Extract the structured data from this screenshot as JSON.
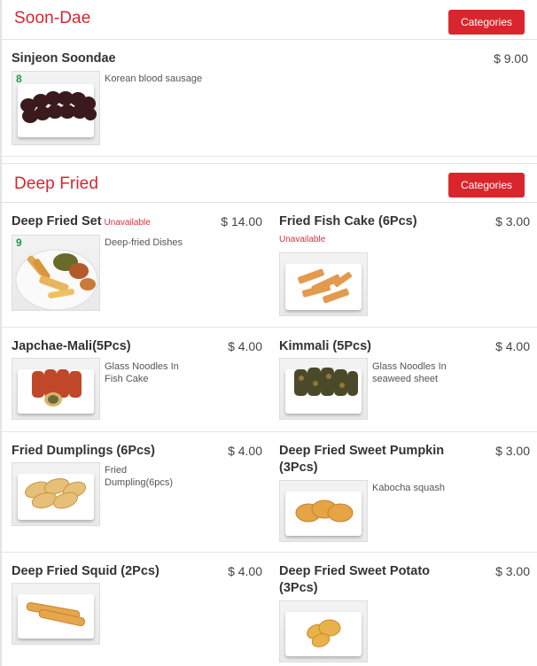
{
  "sections": [
    {
      "title": "Soon-Dae",
      "button": "Categories",
      "items": [
        {
          "name": "Sinjeon Soondae",
          "price": "$ 9.00",
          "desc": "Korean blood sausage",
          "badge": "8",
          "image": "soondae-slices"
        }
      ]
    },
    {
      "title": "Deep Fried",
      "button": "Categories",
      "items": [
        {
          "name": "Deep Fried Set",
          "unavailable": "Unavailable",
          "price": "$ 14.00",
          "desc": "Deep-fried Dishes",
          "badge": "9",
          "image": "fried-platter"
        },
        {
          "name": "Fried Fish Cake (6Pcs)",
          "unavailable": "Unavailable",
          "price": "$ 3.00",
          "desc": "",
          "image": "fish-cake"
        },
        {
          "name": "Japchae-Mali(5Pcs)",
          "price": "$ 4.00",
          "desc_line1": "Glass Noodles In",
          "desc_line2": "Fish Cake",
          "image": "japchae-rolls"
        },
        {
          "name": "Kimmali (5Pcs)",
          "price": "$ 4.00",
          "desc_line1": "Glass Noodles In",
          "desc_line2": "seaweed sheet",
          "image": "seaweed-rolls"
        },
        {
          "name": "Fried Dumplings (6Pcs)",
          "price": "$ 4.00",
          "desc_line1": "Fried",
          "desc_line2": "Dumpling(6pcs)",
          "image": "dumplings"
        },
        {
          "name_line1": "Deep Fried Sweet Pumpkin",
          "name_line2": "(3Pcs)",
          "price": "$ 3.00",
          "desc": "Kabocha squash",
          "image": "pumpkin"
        },
        {
          "name": "Deep Fried Squid (2Pcs)",
          "price": "$ 4.00",
          "desc": "",
          "image": "squid"
        },
        {
          "name_line1": "Deep Fried Sweet Potato",
          "name_line2": "(3Pcs)",
          "price": "$ 3.00",
          "desc": "",
          "image": "sweet-potato"
        }
      ]
    }
  ],
  "colors": {
    "accent": "#d9262c",
    "unavailable": "#e0323a",
    "badge": "#1e9b50"
  }
}
